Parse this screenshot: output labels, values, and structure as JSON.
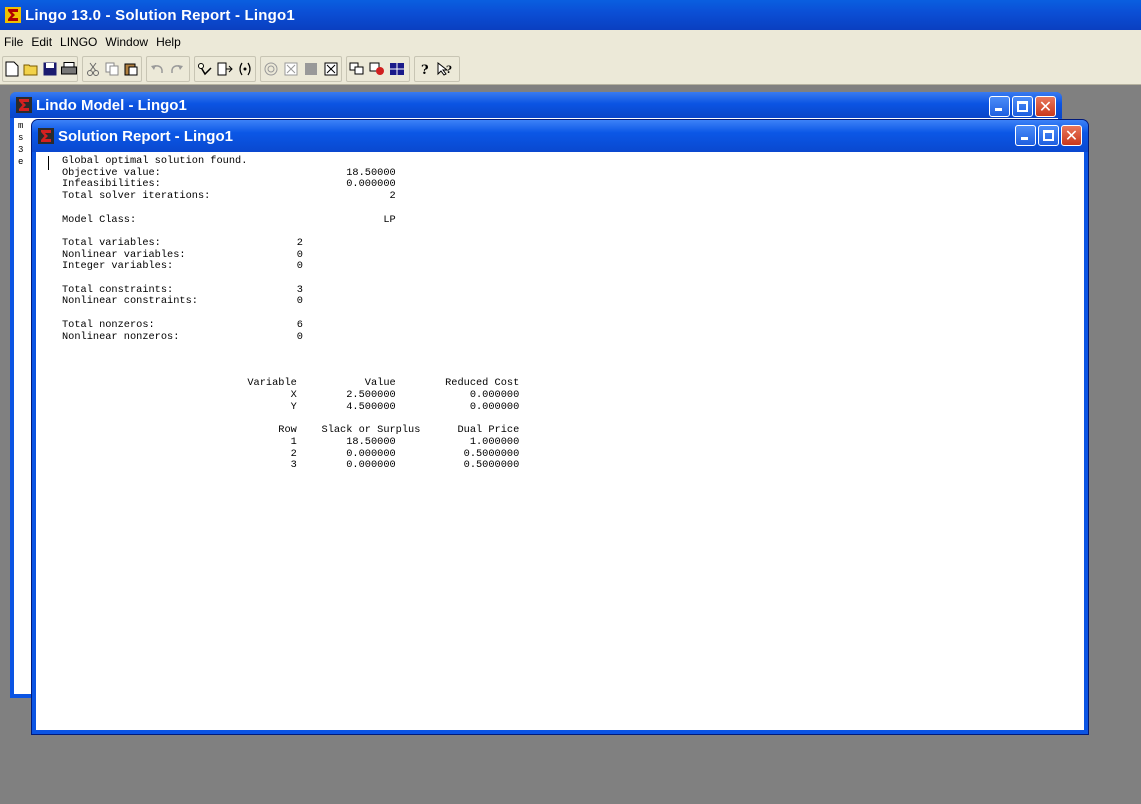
{
  "app": {
    "title": "Lingo 13.0 - Solution Report - Lingo1",
    "icon": "lingo-sigma-icon"
  },
  "menu": [
    "File",
    "Edit",
    "LINGO",
    "Window",
    "Help"
  ],
  "toolbar": {
    "icons": [
      "new-icon",
      "open-icon",
      "save-icon",
      "print-icon",
      "cut-icon",
      "copy-icon",
      "paste-icon",
      "undo-icon",
      "redo-icon",
      "find-icon",
      "goto-line-icon",
      "match-paren-icon",
      "solve-icon",
      "close-all-icon",
      "tile-icon",
      "cascade-icon",
      "send-to-back-icon",
      "options-icon",
      "help-icon",
      "context-help-icon"
    ]
  },
  "lindo_window": {
    "title": "Lindo Model - Lingo1",
    "partial_lines": [
      "m",
      "s",
      "3",
      "e"
    ]
  },
  "solution_window": {
    "title": "Solution Report - Lingo1",
    "report_text": "Global optimal solution found.\nObjective value:                              18.50000\nInfeasibilities:                              0.000000\nTotal solver iterations:                             2\n\nModel Class:                                        LP\n\nTotal variables:                      2\nNonlinear variables:                  0\nInteger variables:                    0\n\nTotal constraints:                    3\nNonlinear constraints:                0\n\nTotal nonzeros:                       6\nNonlinear nonzeros:                   0\n\n\n\n                              Variable           Value        Reduced Cost\n                                     X        2.500000            0.000000\n                                     Y        4.500000            0.000000\n\n                                   Row    Slack or Surplus      Dual Price\n                                     1        18.50000            1.000000\n                                     2        0.000000           0.5000000\n                                     3        0.000000           0.5000000"
  }
}
